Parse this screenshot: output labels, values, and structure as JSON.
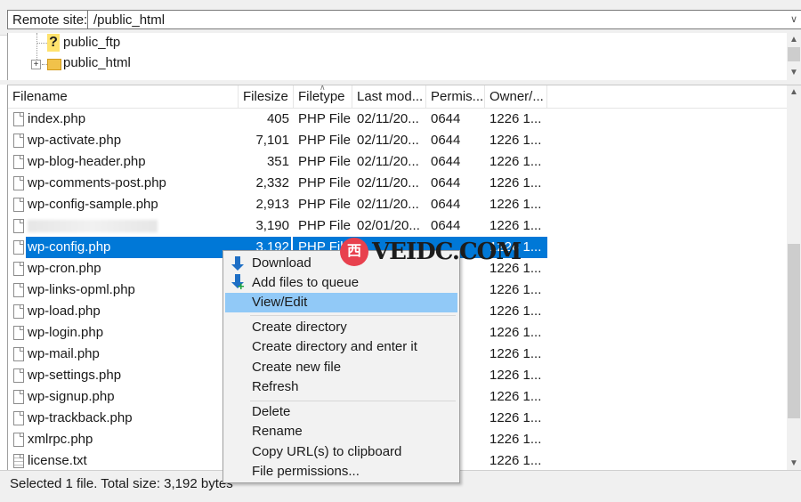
{
  "site_bar": {
    "label": "Remote site:",
    "path": "/public_html"
  },
  "tree": {
    "items": [
      {
        "label": "public_ftp"
      },
      {
        "label": "public_html"
      }
    ]
  },
  "columns": [
    "Filename",
    "Filesize",
    "Filetype",
    "Last mod...",
    "Permis...",
    "Owner/..."
  ],
  "files": [
    {
      "name": "index.php",
      "size": "405",
      "type": "PHP File",
      "date": "02/11/20...",
      "perm": "0644",
      "owner": "1226 1..."
    },
    {
      "name": "wp-activate.php",
      "size": "7,101",
      "type": "PHP File",
      "date": "02/11/20...",
      "perm": "0644",
      "owner": "1226 1..."
    },
    {
      "name": "wp-blog-header.php",
      "size": "351",
      "type": "PHP File",
      "date": "02/11/20...",
      "perm": "0644",
      "owner": "1226 1..."
    },
    {
      "name": "wp-comments-post.php",
      "size": "2,332",
      "type": "PHP File",
      "date": "02/11/20...",
      "perm": "0644",
      "owner": "1226 1..."
    },
    {
      "name": "wp-config-sample.php",
      "size": "2,913",
      "type": "PHP File",
      "date": "02/11/20...",
      "perm": "0644",
      "owner": "1226 1..."
    },
    {
      "name": "",
      "size": "3,190",
      "type": "PHP File",
      "date": "02/01/20...",
      "perm": "0644",
      "owner": "1226 1..."
    },
    {
      "name": "wp-config.php",
      "size": "3,192",
      "type": "PHP File",
      "date": "",
      "perm": "",
      "owner": "1226 1..."
    },
    {
      "name": "wp-cron.php",
      "size": "",
      "type": "",
      "date": "",
      "perm": "",
      "owner": "1226 1..."
    },
    {
      "name": "wp-links-opml.php",
      "size": "",
      "type": "",
      "date": "",
      "perm": "",
      "owner": "1226 1..."
    },
    {
      "name": "wp-load.php",
      "size": "",
      "type": "",
      "date": "",
      "perm": "",
      "owner": "1226 1..."
    },
    {
      "name": "wp-login.php",
      "size": "",
      "type": "",
      "date": "",
      "perm": "",
      "owner": "1226 1..."
    },
    {
      "name": "wp-mail.php",
      "size": "",
      "type": "",
      "date": "",
      "perm": "",
      "owner": "1226 1..."
    },
    {
      "name": "wp-settings.php",
      "size": "",
      "type": "",
      "date": "",
      "perm": "",
      "owner": "1226 1..."
    },
    {
      "name": "wp-signup.php",
      "size": "",
      "type": "",
      "date": "",
      "perm": "",
      "owner": "1226 1..."
    },
    {
      "name": "wp-trackback.php",
      "size": "",
      "type": "",
      "date": "",
      "perm": "",
      "owner": "1226 1..."
    },
    {
      "name": "xmlrpc.php",
      "size": "",
      "type": "",
      "date": "",
      "perm": "",
      "owner": "1226 1..."
    },
    {
      "name": "license.txt",
      "size": "",
      "type": "",
      "date": "",
      "perm": "",
      "owner": "1226 1..."
    }
  ],
  "context_menu": {
    "download": "Download",
    "add_to_queue": "Add files to queue",
    "view_edit": "View/Edit",
    "create_directory": "Create directory",
    "create_directory_enter": "Create directory and enter it",
    "create_new_file": "Create new file",
    "refresh": "Refresh",
    "delete": "Delete",
    "rename": "Rename",
    "copy_url": "Copy URL(s) to clipboard",
    "file_permissions": "File permissions..."
  },
  "status": {
    "text": "Selected 1 file. Total size: 3,192 bytes"
  },
  "watermark": {
    "badge": "西",
    "text": "VEIDC.COM"
  },
  "colors": {
    "selection": "#0078d7",
    "menu_highlight": "#91c9f7",
    "folder": "#f1c24a"
  }
}
